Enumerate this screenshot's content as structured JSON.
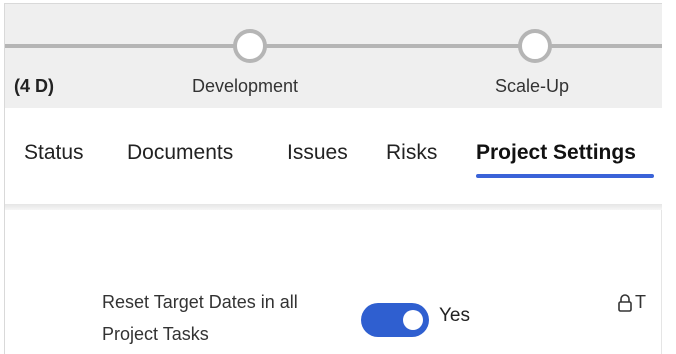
{
  "stages": {
    "duration_label": "(4 D)",
    "items": [
      {
        "label": "Development"
      },
      {
        "label": "Scale-Up"
      }
    ]
  },
  "tabs": [
    {
      "label": "Status",
      "active": false
    },
    {
      "label": "Documents",
      "active": false
    },
    {
      "label": "Issues",
      "active": false
    },
    {
      "label": "Risks",
      "active": false
    },
    {
      "label": "Project Settings",
      "active": true
    }
  ],
  "settings": {
    "reset_target_dates": {
      "label": "Reset Target Dates in all Project Tasks",
      "value_label": "Yes",
      "enabled": true
    },
    "locked_field": {
      "icon": "lock-icon",
      "label_fragment": "T"
    }
  },
  "colors": {
    "accent": "#3a63d8",
    "toggle_on": "#2f5fd0",
    "stage_bar": "#efefef",
    "stage_line": "#b5b5b5"
  }
}
